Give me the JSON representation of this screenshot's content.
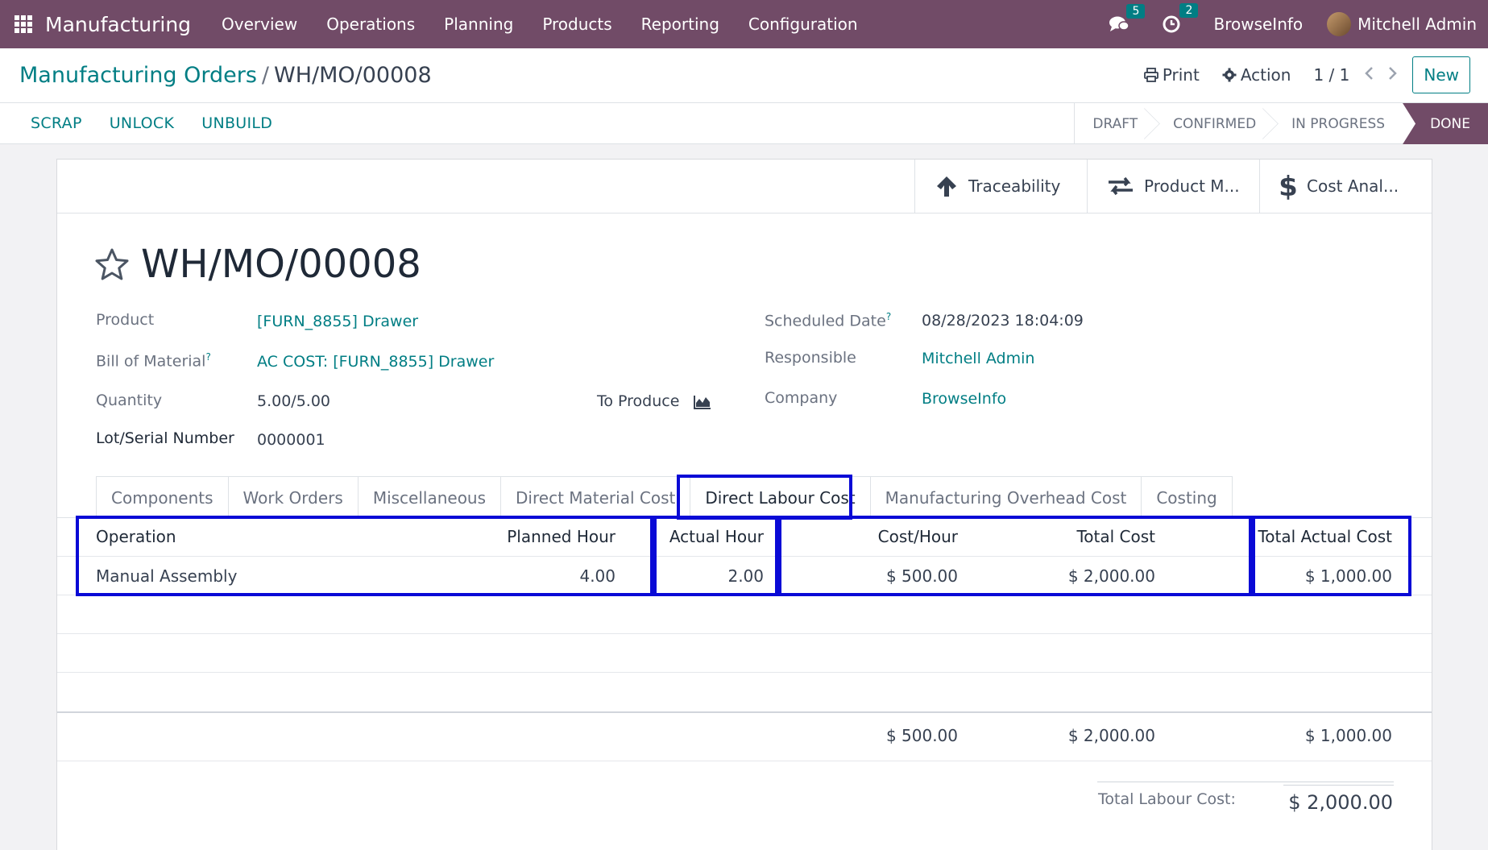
{
  "navbar": {
    "brand": "Manufacturing",
    "menu": [
      "Overview",
      "Operations",
      "Planning",
      "Products",
      "Reporting",
      "Configuration"
    ],
    "messages_count": "5",
    "activities_count": "2",
    "company": "BrowseInfo",
    "user": "Mitchell Admin"
  },
  "control_panel": {
    "breadcrumb_parent": "Manufacturing Orders",
    "breadcrumb_separator": "/",
    "breadcrumb_current": "WH/MO/00008",
    "print_label": "Print",
    "action_label": "Action",
    "pager": "1 / 1",
    "new_label": "New"
  },
  "statusbar": {
    "buttons": [
      "SCRAP",
      "UNLOCK",
      "UNBUILD"
    ],
    "stages": [
      "DRAFT",
      "CONFIRMED",
      "IN PROGRESS",
      "DONE"
    ],
    "active_stage": "DONE"
  },
  "smart_buttons": [
    "Traceability",
    "Product M...",
    "Cost Anal..."
  ],
  "record": {
    "title": "WH/MO/00008",
    "product_label": "Product",
    "product_value": "[FURN_8855] Drawer",
    "bom_label": "Bill of Material",
    "bom_value": "AC COST: [FURN_8855] Drawer",
    "quantity_label": "Quantity",
    "quantity_value": "5.00/5.00",
    "to_produce_label": "To Produce",
    "lot_label": "Lot/Serial Number",
    "lot_value": "0000001",
    "scheduled_label": "Scheduled Date",
    "scheduled_value": "08/28/2023 18:04:09",
    "responsible_label": "Responsible",
    "responsible_value": "Mitchell Admin",
    "company_label": "Company",
    "company_value": "BrowseInfo",
    "help_mark": "?"
  },
  "tabs": [
    "Components",
    "Work Orders",
    "Miscellaneous",
    "Direct Material Cost",
    "Direct Labour Cost",
    "Manufacturing Overhead Cost",
    "Costing"
  ],
  "active_tab": "Direct Labour Cost",
  "labour_table": {
    "headers": {
      "operation": "Operation",
      "planned_hour": "Planned Hour",
      "actual_hour": "Actual Hour",
      "cost_hour": "Cost/Hour",
      "total_cost": "Total Cost",
      "total_actual_cost": "Total Actual Cost"
    },
    "rows": [
      {
        "operation": "Manual Assembly",
        "planned_hour": "4.00",
        "actual_hour": "2.00",
        "cost_hour": "$ 500.00",
        "total_cost": "$ 2,000.00",
        "total_actual_cost": "$ 1,000.00"
      }
    ],
    "totals": {
      "cost_hour": "$ 500.00",
      "total_cost": "$ 2,000.00",
      "total_actual_cost": "$ 1,000.00"
    }
  },
  "summary": {
    "label": "Total Labour Cost:",
    "value": "$ 2,000.00"
  }
}
